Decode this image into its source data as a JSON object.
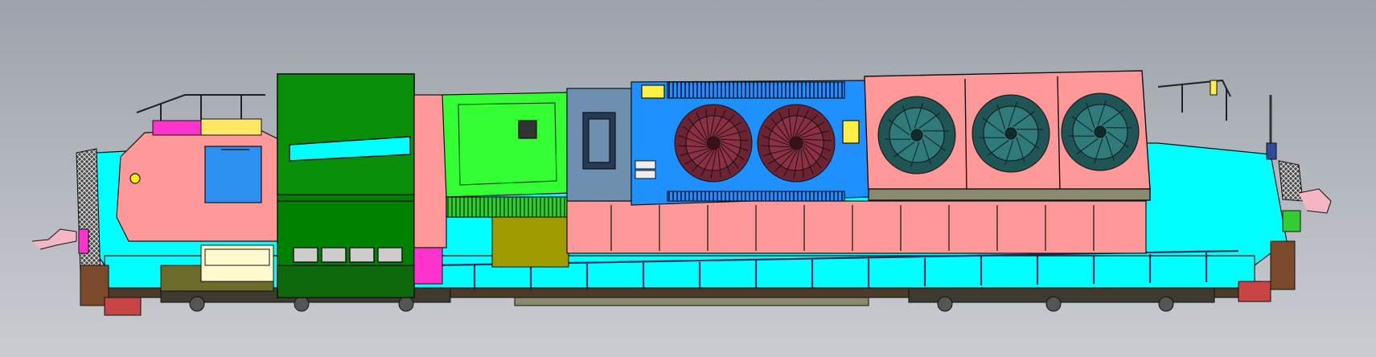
{
  "viewport": {
    "background_top": "#9ea3ab",
    "background_bottom": "#c9ccd1"
  },
  "colors": {
    "deck": "#00ffff",
    "hood_pink": "#ff9999",
    "cab_green": "#008000",
    "panel_lime": "#33ff33",
    "radiator_blue": "#1e90ff",
    "steel_blue": "#6f8fb0",
    "olive": "#a09b00",
    "magenta": "#ff33cc",
    "yellow": "#ffee44",
    "fan_dark": "#1f5555",
    "fan_maroon": "#6a2434",
    "frame_dark": "#4a3b2a",
    "outline": "#111111"
  },
  "model": {
    "name": "locomotive-3d-model",
    "radiator_fans": 2,
    "cooling_fans": 3,
    "handrail_posts": 16,
    "wheel_trucks": 2
  }
}
